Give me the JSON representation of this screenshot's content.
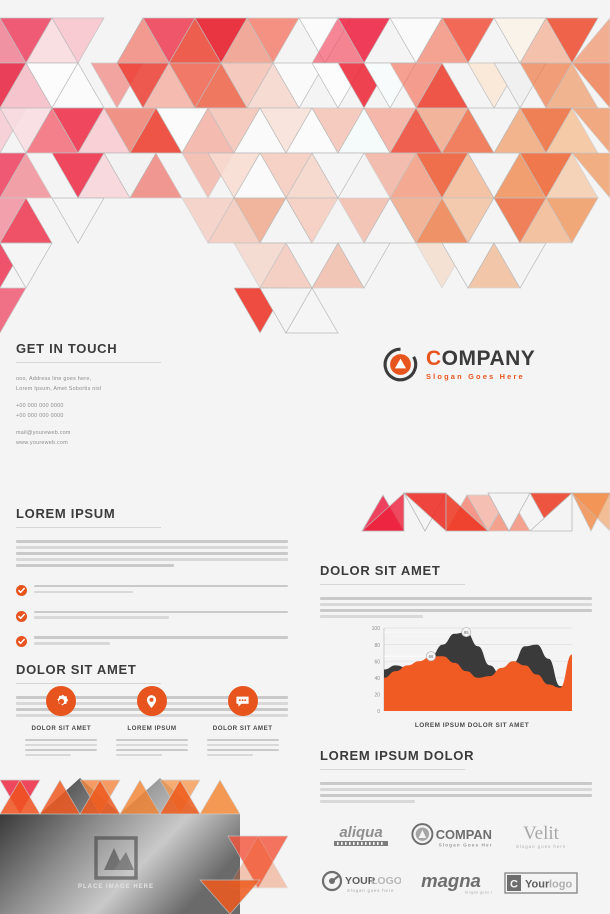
{
  "brand": {
    "accent": "#e8541e",
    "chart_orange": "#f05a23",
    "chart_dark": "#3a3a3a",
    "dark_text": "#3b3b3b"
  },
  "contact": {
    "heading": "GET IN TOUCH",
    "address_line1": "ooo, Address line goes here,",
    "address_line2": "Lorem Ipsum, Amet Sobortis nisl",
    "phone1": "+00 000 000 0000",
    "phone2": "+00 000 000 0000",
    "email": "mail@youreweb.com",
    "website": "www.youreweb.com"
  },
  "logo": {
    "name_first": "C",
    "name_rest": "OMPANY",
    "slogan": "Slogan Goes Here",
    "mark": "circle-triangle-logo-icon"
  },
  "left_column": {
    "heading_1": "LOREM IPSUM",
    "heading_2": "DOLOR SIT AMET",
    "check_icon": "check-circle-icon"
  },
  "features": [
    {
      "icon": "gear-icon",
      "label": "DOLOR SIT AMET"
    },
    {
      "icon": "location-pin-icon",
      "label": "LOREM IPSUM"
    },
    {
      "icon": "chat-bubble-icon",
      "label": "DOLOR SIT AMET"
    }
  ],
  "photo_placeholder": {
    "caption": "PLACE IMAGE HERE",
    "icon": "image-placeholder-icon"
  },
  "right_column": {
    "heading_1": "DOLOR SIT AMET",
    "heading_2": "LOREM IPSUM DOLOR"
  },
  "chart_data": {
    "type": "area",
    "title": "",
    "xlabel": "LOREM IPSUM DOLOR SIT AMET",
    "ylabel": "",
    "ylim": [
      0,
      100
    ],
    "yticks": [
      0,
      20,
      40,
      60,
      80,
      100
    ],
    "grid": true,
    "legend": "none",
    "x": [
      0,
      1,
      2,
      3,
      4,
      5,
      6,
      7,
      8,
      9,
      10,
      11,
      12,
      13,
      14,
      15,
      16
    ],
    "series": [
      {
        "name": "dark",
        "color": "#3a3a3a",
        "values": [
          50,
          55,
          52,
          58,
          66,
          80,
          93,
          95,
          78,
          55,
          42,
          58,
          78,
          80,
          63,
          30,
          28
        ]
      },
      {
        "name": "orange",
        "color": "#f05a23",
        "values": [
          40,
          48,
          55,
          60,
          66,
          66,
          58,
          48,
          40,
          42,
          52,
          60,
          55,
          44,
          32,
          28,
          68
        ]
      }
    ],
    "annotations": [
      {
        "label": "95",
        "x": 7,
        "y": 95
      },
      {
        "label": "66",
        "x": 4,
        "y": 66
      }
    ]
  },
  "clients": [
    {
      "name": "aliqua",
      "tagline": ""
    },
    {
      "name": "COMPANY",
      "tagline": "Slogan Goes Here"
    },
    {
      "name": "Velit",
      "tagline": "Slogan goes here"
    },
    {
      "name": "YOURLOGO",
      "tagline": "Slogan goes here"
    },
    {
      "name": "magna",
      "tagline": ""
    },
    {
      "name": "Yourlogo",
      "tagline": ""
    }
  ]
}
